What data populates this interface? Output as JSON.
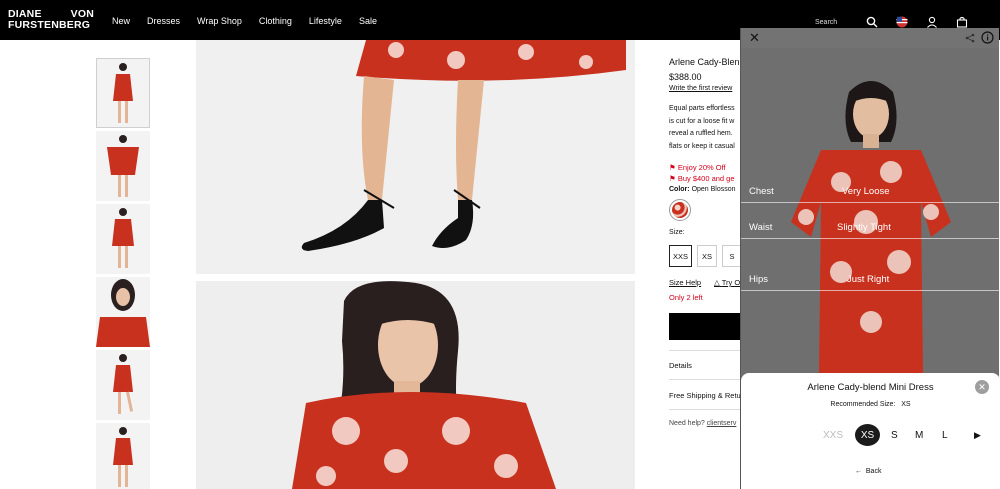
{
  "brand": {
    "line1": "DIANE",
    "line1b": "VON",
    "line2": "FURSTENBERG"
  },
  "nav": {
    "items": [
      "New",
      "Dresses",
      "Wrap Shop",
      "Clothing",
      "Lifestyle",
      "Sale"
    ],
    "search_label": "Search"
  },
  "product": {
    "title": "Arlene Cady-Blen",
    "price": "$388.00",
    "review_link": "Write the first review",
    "description_lines": [
      "Equal parts effortless",
      "is cut for a loose fit w",
      "reveal a ruffled hem.",
      "flats or keep it casual"
    ],
    "promos": [
      "Enjoy 20% Off",
      "Buy $400 and ge"
    ],
    "color_label": "Color:",
    "color_value": "Open Blosson",
    "size_label": "Size:",
    "sizes": [
      "XXS",
      "XS",
      "S"
    ],
    "selected_size": "XXS",
    "size_help": "Size Help",
    "try_on": "Try O",
    "stock": "Only 2 left",
    "details": "Details",
    "shipping": "Free Shipping & Retu",
    "help_prefix": "Need help?",
    "help_link": "clientserv"
  },
  "fit_panel": {
    "measurements": [
      {
        "area": "Chest",
        "fit": "Very Loose"
      },
      {
        "area": "Waist",
        "fit": "Slightly Tight"
      },
      {
        "area": "Hips",
        "fit": "Just Right"
      }
    ],
    "card_title": "Arlene Cady-blend Mini Dress",
    "recommended_label": "Recommended Size:",
    "recommended_value": "XS",
    "size_options": [
      "XXS",
      "XS",
      "S",
      "M",
      "L"
    ],
    "selected_size": "XS",
    "back_label": "Back"
  },
  "colors": {
    "accent_red": "#d0021b",
    "header_bg": "#000000",
    "dress_red": "#c9311f"
  }
}
